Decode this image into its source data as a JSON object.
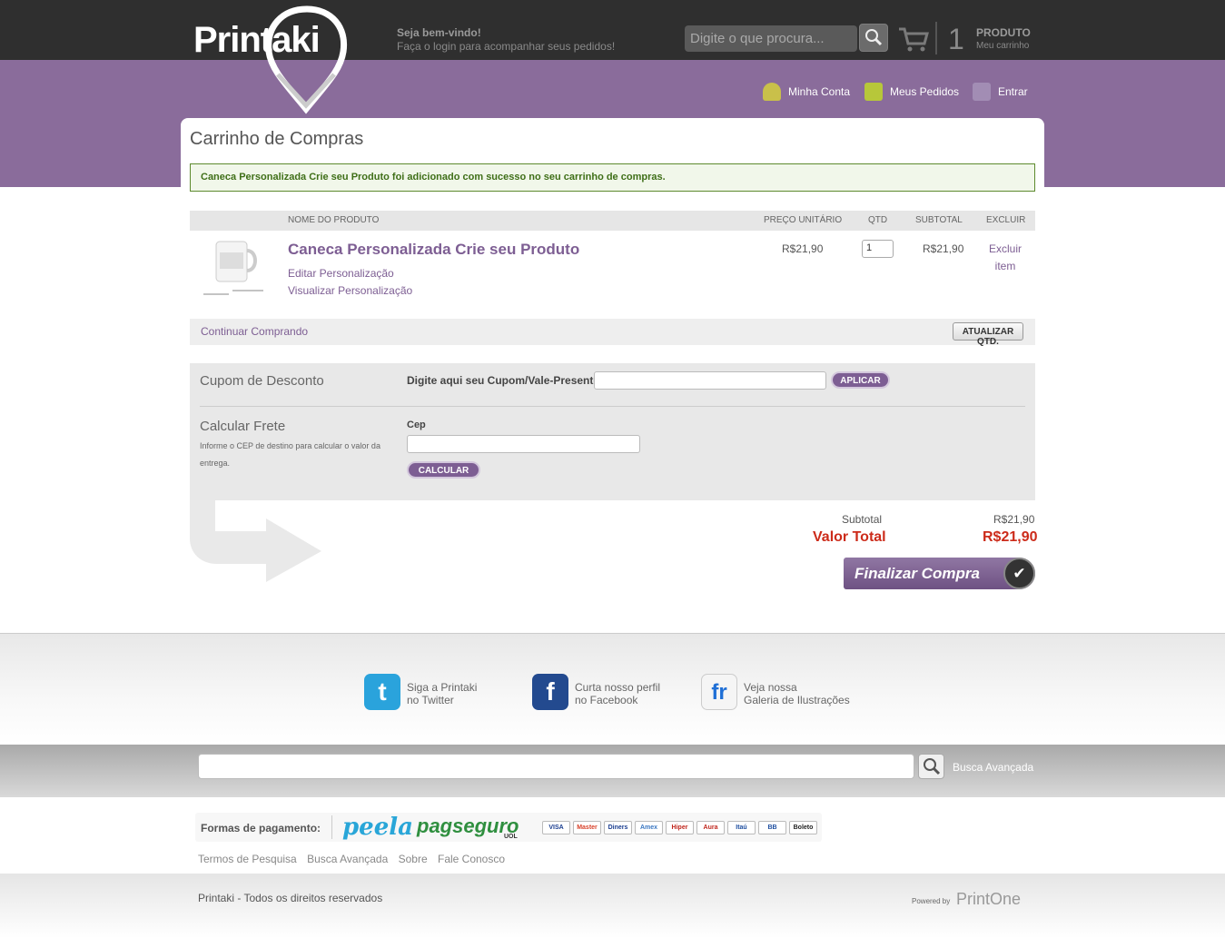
{
  "header": {
    "logo_text": "Printaki",
    "welcome_title": "Seja bem-vindo!",
    "welcome_sub": "Faça o login para acompanhar seus pedidos!",
    "search_placeholder": "Digite o que procura...",
    "cart_count": "1",
    "cart_label": "PRODUTO",
    "cart_sub": "Meu carrinho"
  },
  "user_nav": [
    {
      "label": "Minha Conta",
      "icon": "user-icon"
    },
    {
      "label": "Meus Pedidos",
      "icon": "orders-icon"
    },
    {
      "label": "Entrar",
      "icon": "lock-icon"
    }
  ],
  "main": {
    "title": "Carrinho de Compras",
    "success_message": "Caneca Personalizada Crie seu Produto foi adicionado com sucesso no seu carrinho de compras."
  },
  "cart_table": {
    "headers": {
      "name": "NOME DO PRODUTO",
      "unit_price": "PREÇO UNITÁRIO",
      "qty": "QTD",
      "subtotal": "SUBTOTAL",
      "remove": "EXCLUIR"
    },
    "item": {
      "name": "Caneca Personalizada Crie seu Produto",
      "edit_link": "Editar Personalização",
      "view_link": "Visualizar Personalização",
      "unit_price": "R$21,90",
      "qty": "1",
      "subtotal": "R$21,90",
      "remove": "Excluir item"
    },
    "continue_label": "Continuar Comprando",
    "update_label": "ATUALIZAR QTD."
  },
  "coupon": {
    "title": "Cupom de Desconto",
    "label": "Digite aqui seu Cupom/Vale-Presente.",
    "value": "",
    "button": "APLICAR"
  },
  "shipping": {
    "title": "Calcular Frete",
    "description": "Informe o CEP de destino para calcular o valor da entrega.",
    "cep_label": "Cep",
    "cep_value": "",
    "button": "CALCULAR"
  },
  "totals": {
    "subtotal_label": "Subtotal",
    "subtotal_value": "R$21,90",
    "total_label": "Valor Total",
    "total_value": "R$21,90",
    "finalize_label": "Finalizar Compra"
  },
  "social": [
    {
      "line1": "Siga a Printaki",
      "line2": "no Twitter",
      "glyph": "t",
      "color": "#2aa3dc"
    },
    {
      "line1": "Curta nosso perfil",
      "line2": "no Facebook",
      "glyph": "f",
      "color": "#234a8f"
    },
    {
      "line1": "Veja nossa",
      "line2": "Galeria de Ilustrações",
      "glyph": "fr",
      "color": "#f5f5f5"
    }
  ],
  "footer": {
    "search_value": "",
    "advanced_search": "Busca Avançada",
    "payments_label": "Formas de pagamento:",
    "peela": "peela",
    "pagseguro": "pagseguro",
    "pagseguro_uol": "UOL",
    "cards": [
      "VISA",
      "Master",
      "Diners",
      "Amex",
      "Hiper",
      "Aura",
      "Itaú",
      "BB",
      "Boleto"
    ],
    "links": [
      "Termos de Pesquisa",
      "Busca Avançada",
      "Sobre",
      "Fale Conosco"
    ],
    "copyright": "Printaki - Todos os direitos reservados",
    "powered_by": "Powered by",
    "powered_brand": "PrintOne"
  },
  "colors": {
    "brand_purple": "#8a6c9b",
    "link_purple": "#7d5e93",
    "total_red": "#cc2b1a",
    "success_green": "#3f6f18"
  }
}
